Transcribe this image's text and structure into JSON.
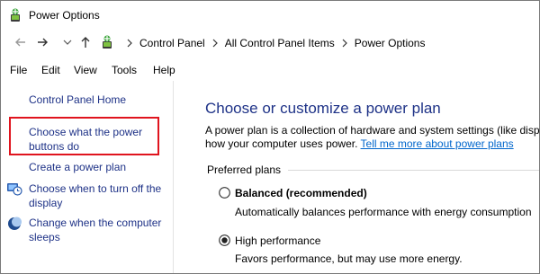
{
  "window": {
    "title": "Power Options"
  },
  "address": {
    "crumbs": [
      "Control Panel",
      "All Control Panel Items",
      "Power Options"
    ]
  },
  "menu": {
    "items": [
      "File",
      "Edit",
      "View",
      "Tools",
      "Help"
    ]
  },
  "left_pane": {
    "home": "Control Panel Home",
    "links": [
      {
        "label": "Choose what the power buttons do",
        "icon": "none",
        "highlighted": true
      },
      {
        "label": "Create a power plan",
        "icon": "none"
      },
      {
        "label": "Choose when to turn off the display",
        "icon": "monitor-clock-icon"
      },
      {
        "label": "Change when the computer sleeps",
        "icon": "moon-icon"
      }
    ]
  },
  "main": {
    "title": "Choose or customize a power plan",
    "description_line1": "A power plan is a collection of hardware and system settings (like disp",
    "description_line2_prefix": "how your computer uses power. ",
    "description_link": "Tell me more about power plans",
    "preferred_label": "Preferred plans",
    "plans": [
      {
        "name": "Balanced (recommended)",
        "description": "Automatically balances performance with energy consumption",
        "selected": false
      },
      {
        "name": "High performance",
        "description": "Favors performance, but may use more energy.",
        "selected": true
      }
    ]
  },
  "colors": {
    "link": "#1e3287",
    "hyperlink": "#0066cc",
    "highlight_border": "#e0141e"
  }
}
